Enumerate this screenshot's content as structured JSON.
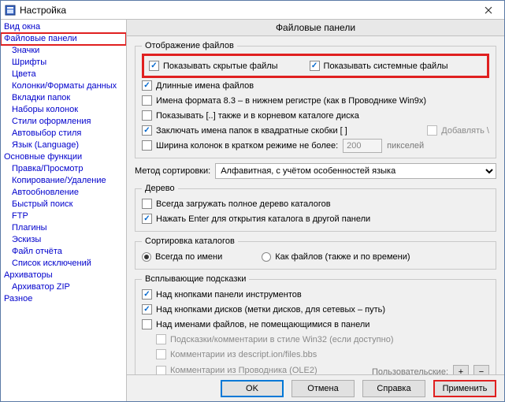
{
  "window": {
    "title": "Настройка"
  },
  "sidebar": {
    "items": [
      {
        "label": "Вид окна",
        "indent": false
      },
      {
        "label": "Файловые панели",
        "indent": false,
        "selected": true
      },
      {
        "label": "Значки",
        "indent": true
      },
      {
        "label": "Шрифты",
        "indent": true
      },
      {
        "label": "Цвета",
        "indent": true
      },
      {
        "label": "Колонки/Форматы данных",
        "indent": true
      },
      {
        "label": "Вкладки папок",
        "indent": true
      },
      {
        "label": "Наборы колонок",
        "indent": true
      },
      {
        "label": "Стили оформления",
        "indent": true
      },
      {
        "label": "Автовыбор стиля",
        "indent": true
      },
      {
        "label": "Язык (Language)",
        "indent": true
      },
      {
        "label": "Основные функции",
        "indent": false
      },
      {
        "label": "Правка/Просмотр",
        "indent": true
      },
      {
        "label": "Копирование/Удаление",
        "indent": true
      },
      {
        "label": "Автообновление",
        "indent": true
      },
      {
        "label": "Быстрый поиск",
        "indent": true
      },
      {
        "label": "FTP",
        "indent": true
      },
      {
        "label": "Плагины",
        "indent": true
      },
      {
        "label": "Эскизы",
        "indent": true
      },
      {
        "label": "Файл отчёта",
        "indent": true
      },
      {
        "label": "Список исключений",
        "indent": true
      },
      {
        "label": "Архиваторы",
        "indent": false
      },
      {
        "label": "Архиватор ZIP",
        "indent": true
      },
      {
        "label": "Разное",
        "indent": false
      }
    ]
  },
  "page": {
    "header": "Файловые панели",
    "group_display": {
      "legend": "Отображение файлов",
      "hidden": "Показывать скрытые файлы",
      "system": "Показывать системные файлы",
      "long_names": "Длинные имена файлов",
      "fmt83": "Имена формата 8.3 – в нижнем регистре (как в Проводнике Win9x)",
      "show_dotdot": "Показывать [..] также и в корневом каталоге диска",
      "brackets": "Заключать имена папок в квадратные скобки [ ]",
      "append_backslash": "Добавлять \\",
      "col_width_label": "Ширина колонок в кратком режиме не более:",
      "col_width_value": "200",
      "col_width_unit": "пикселей"
    },
    "sort": {
      "method_label": "Метод сортировки:",
      "method_value": "Алфавитная, с учётом особенностей языка"
    },
    "group_tree": {
      "legend": "Дерево",
      "always_load": "Всегда загружать полное дерево каталогов",
      "enter_opens": "Нажать Enter для открытия каталога в другой панели"
    },
    "group_dirsort": {
      "legend": "Сортировка каталогов",
      "by_name": "Всегда по имени",
      "like_files": "Как файлов (также и по времени)"
    },
    "group_tooltips": {
      "legend": "Всплывающие подсказки",
      "over_toolbar": "Над кнопками панели инструментов",
      "over_drive": "Над кнопками дисков (метки дисков, для сетевых – путь)",
      "over_truncated": "Над именами файлов, не помещающимися в панели",
      "win32": "Подсказки/комментарии в стиле Win32 (если доступно)",
      "descript": "Комментарии из descript.ion/files.bbs",
      "ole2": "Комментарии из Проводника (OLE2)",
      "user_label": "Пользовательские:"
    }
  },
  "buttons": {
    "ok": "OK",
    "cancel": "Отмена",
    "help": "Справка",
    "apply": "Применить"
  }
}
